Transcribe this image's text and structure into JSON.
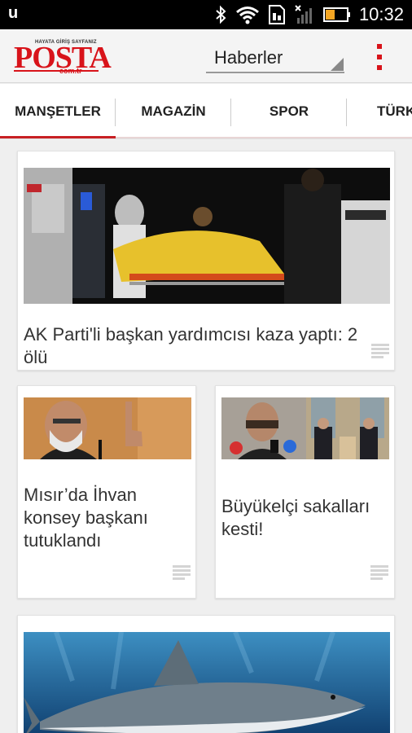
{
  "status_bar": {
    "time": "10:32",
    "left_icon": "u",
    "icons": [
      "bluetooth-icon",
      "wifi-icon",
      "sim-icon",
      "signal-icon",
      "battery-icon"
    ]
  },
  "app_bar": {
    "logo": {
      "word": "POSTA",
      "tagline": "HAYATA GİRİŞ SAYFANIZ",
      "domain": "com.tr"
    },
    "section_dropdown": {
      "selected": "Haberler"
    },
    "menu_icon": "overflow-menu-icon",
    "accent_color": "#d8131a"
  },
  "tabs": [
    {
      "label": "MANŞETLER",
      "active": true
    },
    {
      "label": "MAGAZİN",
      "active": false
    },
    {
      "label": "SPOR",
      "active": false
    },
    {
      "label": "TÜRK",
      "active": false
    }
  ],
  "articles": [
    {
      "headline": "AK Parti'li başkan yardımcısı kaza yaptı: 2 ölü",
      "image": "accident-stretcher-photo"
    },
    {
      "headline": "Mısır’da İhvan konsey başkanı tutuklandı",
      "image": "man-speaking-photo"
    },
    {
      "headline": "Büyükelçi sakalları kesti!",
      "image": "ambassador-collage-photo"
    },
    {
      "headline": "",
      "image": "shark-underwater-photo"
    }
  ]
}
